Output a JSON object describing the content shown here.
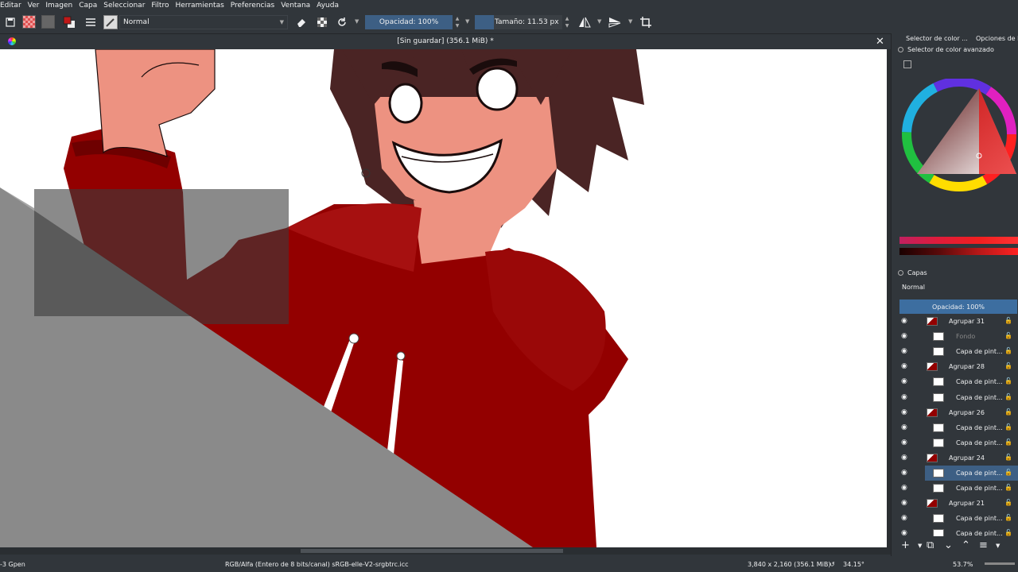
{
  "menu": [
    "Editar",
    "Ver",
    "Imagen",
    "Capa",
    "Seleccionar",
    "Filtro",
    "Herramientas",
    "Preferencias",
    "Ventana",
    "Ayuda"
  ],
  "toolbar": {
    "blend_mode": "Normal",
    "opacity_label": "Opacidad: 100%",
    "size_label": "Tamaño: 11.53 px"
  },
  "document": {
    "title": "[Sin guardar]  (356.1 MiB) *"
  },
  "dock": {
    "tab_color": "Selector de color ...",
    "tab_options": "Opciones de la",
    "advanced_selector": "Selector de color avanzado",
    "layers_title": "Capas",
    "layers_blend": "Normal",
    "layers_opacity": "Opacidad:  100%"
  },
  "layers": [
    {
      "name": "Agrupar 31",
      "indent": 0
    },
    {
      "name": "Fondo",
      "indent": 1
    },
    {
      "name": "Capa de pint...",
      "indent": 1
    },
    {
      "name": "Agrupar 28",
      "indent": 0
    },
    {
      "name": "Capa de pint...",
      "indent": 1
    },
    {
      "name": "Capa de pint...",
      "indent": 1
    },
    {
      "name": "Agrupar 26",
      "indent": 0
    },
    {
      "name": "Capa de pint...",
      "indent": 1
    },
    {
      "name": "Capa de pint...",
      "indent": 1
    },
    {
      "name": "Agrupar 24",
      "indent": 0
    },
    {
      "name": "Capa de pint...",
      "indent": 1
    },
    {
      "name": "Capa de pint...",
      "indent": 1
    },
    {
      "name": "Agrupar 21",
      "indent": 0
    },
    {
      "name": "Capa de pint...",
      "indent": 1
    },
    {
      "name": "Capa de pint...",
      "indent": 1
    }
  ],
  "status": {
    "brush": "-3 Gpen",
    "color_space": "RGB/Alfa (Entero de 8 bits/canal)  sRGB-elle-V2-srgbtrc.icc",
    "dimensions": "3,840 x 2,160 (356.1 MiB)",
    "rotation": "34.15°",
    "zoom": "53.7%"
  },
  "colors": {
    "accent": "#3d5f84",
    "bg": "#31363b",
    "hoodie": "#930000",
    "skin": "#ed9281",
    "hair": "#4a2424"
  }
}
